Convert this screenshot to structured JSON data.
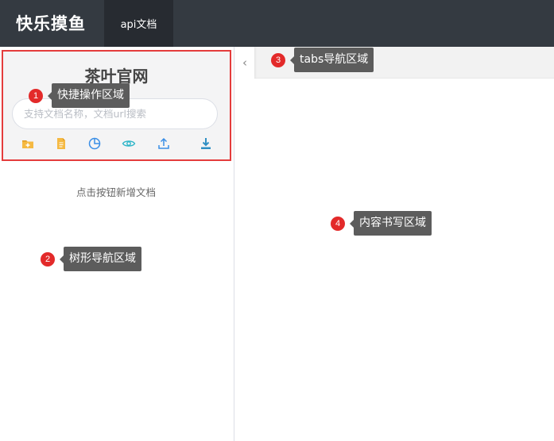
{
  "header": {
    "logo": "快乐摸鱼",
    "tab_label": "api文档"
  },
  "sidebar": {
    "site_title": "茶叶官网",
    "search_placeholder": "支持文档名称，文档url搜索",
    "icons": [
      "new-folder-icon",
      "new-doc-icon",
      "pie-chart-icon",
      "eye-icon",
      "upload-icon",
      "download-icon"
    ],
    "empty_hint": "点击按钮新增文档"
  },
  "tabs": {
    "back_glyph": "‹"
  },
  "annotations": [
    {
      "num": "1",
      "label": "快捷操作区域"
    },
    {
      "num": "2",
      "label": "树形导航区域"
    },
    {
      "num": "3",
      "label": "tabs导航区域"
    },
    {
      "num": "4",
      "label": "内容书写区域"
    }
  ],
  "colors": {
    "header_bg": "#343a41",
    "active_tab_bg": "#272b31",
    "highlight_border": "#e43c3c",
    "marker_red": "#e32a2a",
    "tooltip_bg": "#5c5c5c",
    "icon_orange": "#f5b942",
    "icon_blue": "#3a8ee6",
    "icon_teal": "#2fb5c8"
  }
}
